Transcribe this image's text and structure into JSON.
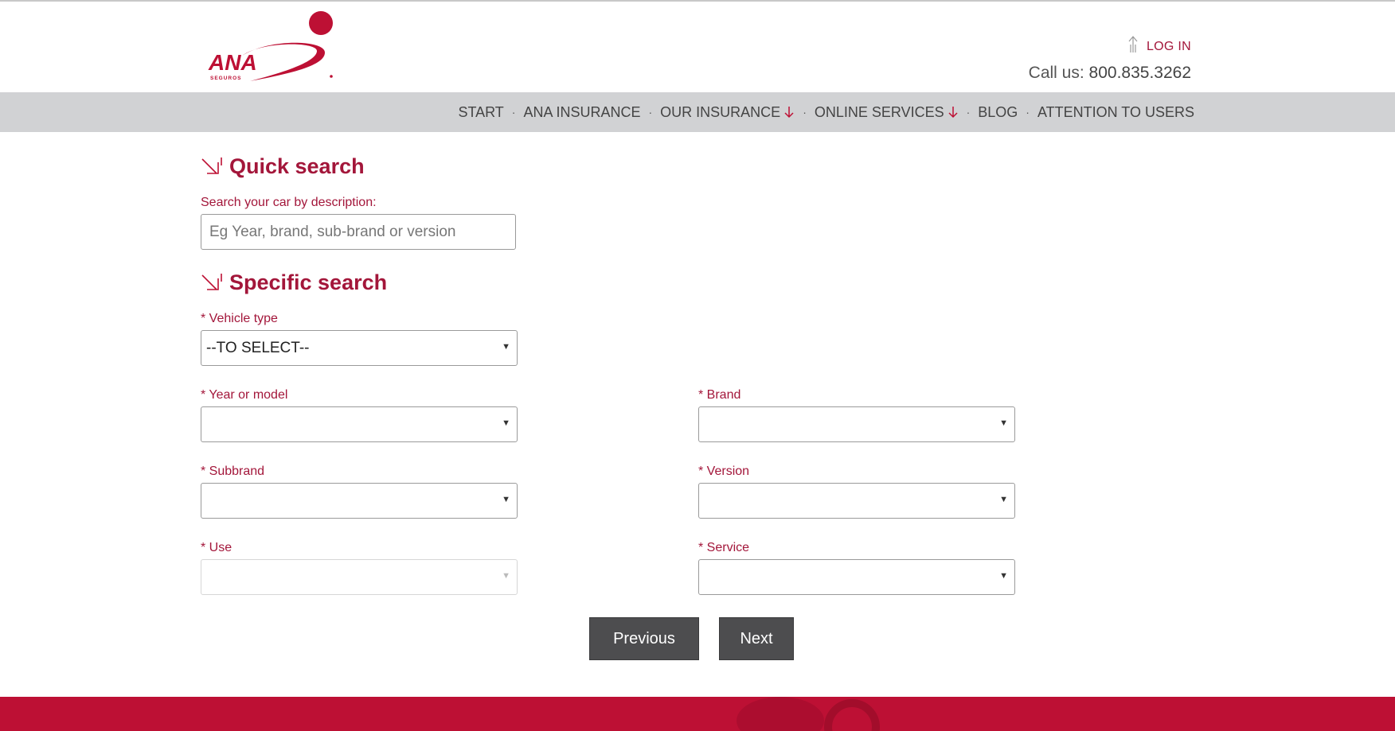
{
  "header": {
    "logo_text": "ANA",
    "logo_subtext": "SEGUROS",
    "login_label": "LOG IN",
    "call_label": "Call us:",
    "phone": "800.835.3262"
  },
  "nav": {
    "items": [
      {
        "label": "START"
      },
      {
        "label": "ANA INSURANCE"
      },
      {
        "label": "OUR INSURANCE"
      },
      {
        "label": "ONLINE SERVICES"
      },
      {
        "label": "BLOG"
      },
      {
        "label": "ATTENTION TO USERS"
      }
    ],
    "separator": "·"
  },
  "quick_search": {
    "title": "Quick search",
    "label": "Search your car by description:",
    "placeholder": "Eg Year, brand, sub-brand or version"
  },
  "specific_search": {
    "title": "Specific search",
    "vehicle_type": {
      "label": "* Vehicle type",
      "value": "--TO SELECT--"
    },
    "year": {
      "label": "* Year or model",
      "value": ""
    },
    "brand": {
      "label": "* Brand",
      "value": ""
    },
    "subbrand": {
      "label": "* Subbrand",
      "value": ""
    },
    "version": {
      "label": "* Version",
      "value": ""
    },
    "use": {
      "label": "* Use",
      "value": ""
    },
    "service": {
      "label": "* Service",
      "value": ""
    }
  },
  "buttons": {
    "previous": "Previous",
    "next": "Next"
  },
  "colors": {
    "accent": "#a3163a",
    "footer": "#bd1034",
    "nav_bg": "#d1d2d4",
    "button_bg": "#4d4d4f"
  }
}
